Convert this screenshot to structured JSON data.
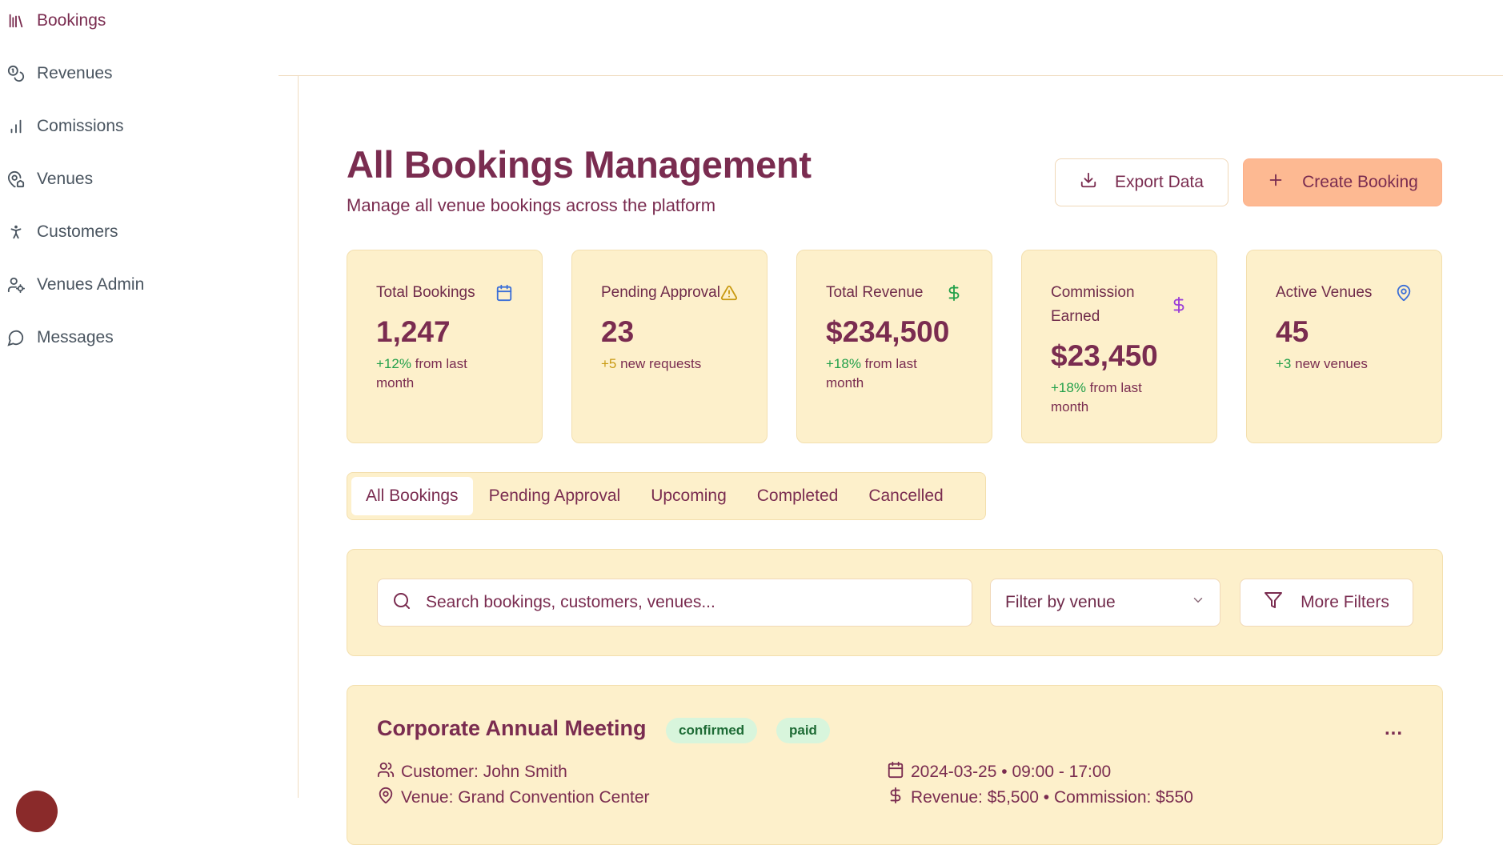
{
  "sidebar": {
    "items": [
      {
        "label": "Bookings",
        "icon": "library-icon",
        "active": true
      },
      {
        "label": "Revenues",
        "icon": "coins-icon",
        "active": false
      },
      {
        "label": "Comissions",
        "icon": "bar-chart-icon",
        "active": false
      },
      {
        "label": "Venues",
        "icon": "map-pin-house-icon",
        "active": false
      },
      {
        "label": "Customers",
        "icon": "person-standing-icon",
        "active": false
      },
      {
        "label": "Venues Admin",
        "icon": "user-cog-icon",
        "active": false
      },
      {
        "label": "Messages",
        "icon": "message-circle-icon",
        "active": false
      }
    ]
  },
  "header": {
    "title": "All Bookings Management",
    "subtitle": "Manage all venue bookings across the platform",
    "export_label": "Export Data",
    "create_label": "Create Booking"
  },
  "stats": [
    {
      "label": "Total Bookings",
      "value": "1,247",
      "delta": "+12%",
      "change": " from last month",
      "icon": "calendar-icon",
      "icon_color": "#3b6fd8",
      "delta_color": "green"
    },
    {
      "label": "Pending Approval",
      "value": "23",
      "delta": "+5",
      "change": " new requests",
      "icon": "warning-icon",
      "icon_color": "#c99a12",
      "delta_color": "amber"
    },
    {
      "label": "Total Revenue",
      "value": "$234,500",
      "delta": "+18%",
      "change": " from last month",
      "icon": "dollar-icon",
      "icon_color": "#22a04a",
      "delta_color": "green"
    },
    {
      "label": "Commission Earned",
      "value": "$23,450",
      "delta": "+18%",
      "change": " from last month",
      "icon": "dollar-icon",
      "icon_color": "#9b3ed8",
      "delta_color": "green"
    },
    {
      "label": "Active Venues",
      "value": "45",
      "delta": "+3",
      "change": " new venues",
      "icon": "map-pin-icon",
      "icon_color": "#3b6fd8",
      "delta_color": "green"
    }
  ],
  "tabs": [
    {
      "label": "All Bookings",
      "active": true
    },
    {
      "label": "Pending Approval",
      "active": false
    },
    {
      "label": "Upcoming",
      "active": false
    },
    {
      "label": "Completed",
      "active": false
    },
    {
      "label": "Cancelled",
      "active": false
    }
  ],
  "filters": {
    "search_placeholder": "Search bookings, customers, venues...",
    "venue_filter": "Filter by venue",
    "more_filters": "More Filters"
  },
  "booking": {
    "title": "Corporate Annual Meeting",
    "status": "confirmed",
    "payment": "paid",
    "more": "...",
    "customer": "Customer: John Smith",
    "venue": "Venue: Grand Convention Center",
    "datetime": "2024-03-25 • 09:00 - 17:00",
    "revenue": "Revenue: $5,500 • Commission: $550"
  },
  "colors": {
    "brand": "#7a2c50",
    "card_bg": "#fdf0cb",
    "primary_button": "#fdb992",
    "badge_bg": "#d8f5dc",
    "positive": "#22a04a"
  }
}
